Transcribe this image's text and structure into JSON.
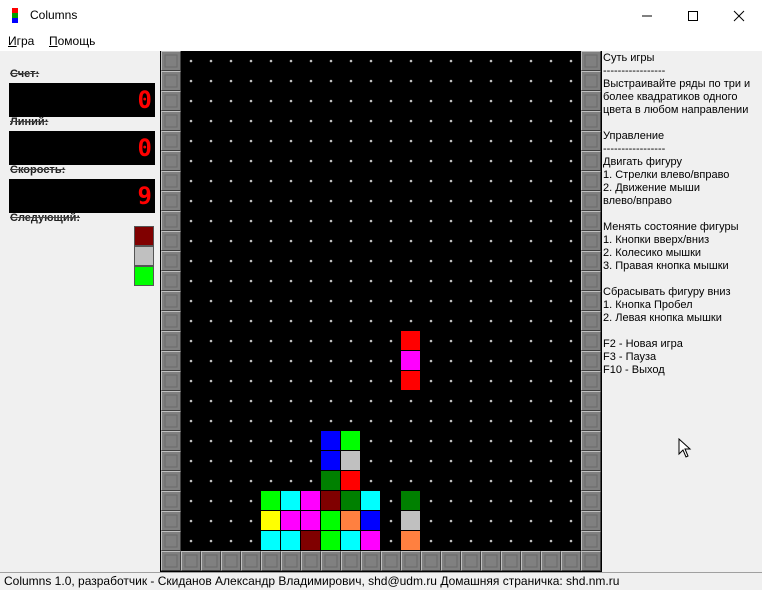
{
  "window": {
    "title": "Columns",
    "minimize": "—",
    "maximize": "☐",
    "close": "✕"
  },
  "menu": [
    {
      "first": "И",
      "rest": "гра"
    },
    {
      "first": "П",
      "rest": "омощь"
    }
  ],
  "left": {
    "score_label": "Счет:",
    "score": "0",
    "lines_label": "Линий:",
    "lines": "0",
    "speed_label": "Скорость:",
    "speed": "9",
    "next_label": "Следующий:",
    "next_colors": [
      "#800000",
      "#c0c0c0",
      "#00ff00"
    ]
  },
  "board": {
    "cols": 20,
    "rows": 25,
    "falling": [
      {
        "col": 11,
        "row": 14,
        "color": "#ff0000"
      },
      {
        "col": 11,
        "row": 15,
        "color": "#ff00ff"
      },
      {
        "col": 11,
        "row": 16,
        "color": "#ff0000"
      }
    ],
    "cells": [
      {
        "col": 7,
        "row": 19,
        "color": "#0000ff"
      },
      {
        "col": 8,
        "row": 19,
        "color": "#00ff00"
      },
      {
        "col": 7,
        "row": 20,
        "color": "#0000ff"
      },
      {
        "col": 8,
        "row": 20,
        "color": "#c0c0c0"
      },
      {
        "col": 7,
        "row": 21,
        "color": "#008000"
      },
      {
        "col": 8,
        "row": 21,
        "color": "#ff0000"
      },
      {
        "col": 4,
        "row": 22,
        "color": "#00ff00"
      },
      {
        "col": 5,
        "row": 22,
        "color": "#00ffff"
      },
      {
        "col": 6,
        "row": 22,
        "color": "#ff00ff"
      },
      {
        "col": 7,
        "row": 22,
        "color": "#800000"
      },
      {
        "col": 8,
        "row": 22,
        "color": "#008000"
      },
      {
        "col": 9,
        "row": 22,
        "color": "#00ffff"
      },
      {
        "col": 11,
        "row": 22,
        "color": "#008000"
      },
      {
        "col": 4,
        "row": 23,
        "color": "#ffff00"
      },
      {
        "col": 5,
        "row": 23,
        "color": "#ff00ff"
      },
      {
        "col": 6,
        "row": 23,
        "color": "#ff00ff"
      },
      {
        "col": 7,
        "row": 23,
        "color": "#00ff00"
      },
      {
        "col": 8,
        "row": 23,
        "color": "#ff8040"
      },
      {
        "col": 9,
        "row": 23,
        "color": "#0000ff"
      },
      {
        "col": 11,
        "row": 23,
        "color": "#c0c0c0"
      },
      {
        "col": 4,
        "row": 24,
        "color": "#00ffff"
      },
      {
        "col": 5,
        "row": 24,
        "color": "#00ffff"
      },
      {
        "col": 6,
        "row": 24,
        "color": "#800000"
      },
      {
        "col": 7,
        "row": 24,
        "color": "#00ff00"
      },
      {
        "col": 8,
        "row": 24,
        "color": "#00ffff"
      },
      {
        "col": 9,
        "row": 24,
        "color": "#ff00ff"
      },
      {
        "col": 11,
        "row": 24,
        "color": "#ff8040"
      }
    ]
  },
  "help": [
    "Суть игры",
    "-----------------",
    "Выстраивайте ряды по три и",
    "более квадратиков одного",
    "цвета в любом направлении",
    "",
    "Управление",
    "-----------------",
    "Двигать фигуру",
    "1. Стрелки влево/вправо",
    "2. Движение мыши",
    "влево/вправо",
    "",
    "Менять состояние фигуры",
    "1. Кнопки вверх/вниз",
    "2. Колесико мышки",
    "3. Правая кнопка мышки",
    "",
    "Сбрасывать фигуру вниз",
    "1. Кнопка Пробел",
    "2. Левая кнопка мышки",
    "",
    "F2 - Новая игра",
    "F3 - Пауза",
    "F10 - Выход"
  ],
  "status": "Columns 1.0, разработчик - Скиданов Александр Владимирович, shd@udm.ru Домашняя страничка: shd.nm.ru"
}
